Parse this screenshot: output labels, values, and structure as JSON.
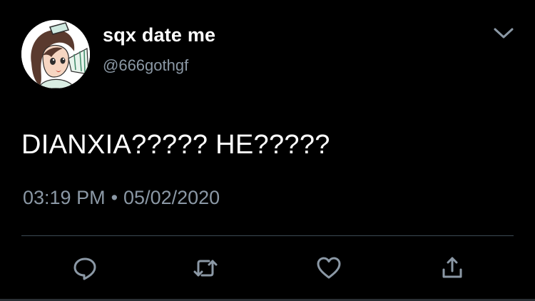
{
  "tweet": {
    "author": {
      "display_name": "sqx date me",
      "handle": "@666gothgf",
      "avatar_icon": "avatar-illustration"
    },
    "text": "DIANXIA????? HE?????",
    "time": "03:19 PM",
    "separator": "•",
    "date": "05/02/2020",
    "menu_icon": "chevron-down-icon"
  },
  "actions": [
    {
      "name": "reply",
      "icon": "reply-icon"
    },
    {
      "name": "retweet",
      "icon": "retweet-icon"
    },
    {
      "name": "like",
      "icon": "heart-icon"
    },
    {
      "name": "share",
      "icon": "share-icon"
    }
  ],
  "colors": {
    "background": "#000000",
    "primary_text": "#ffffff",
    "secondary_text": "#8b98a5",
    "divider": "#3d4a55"
  }
}
